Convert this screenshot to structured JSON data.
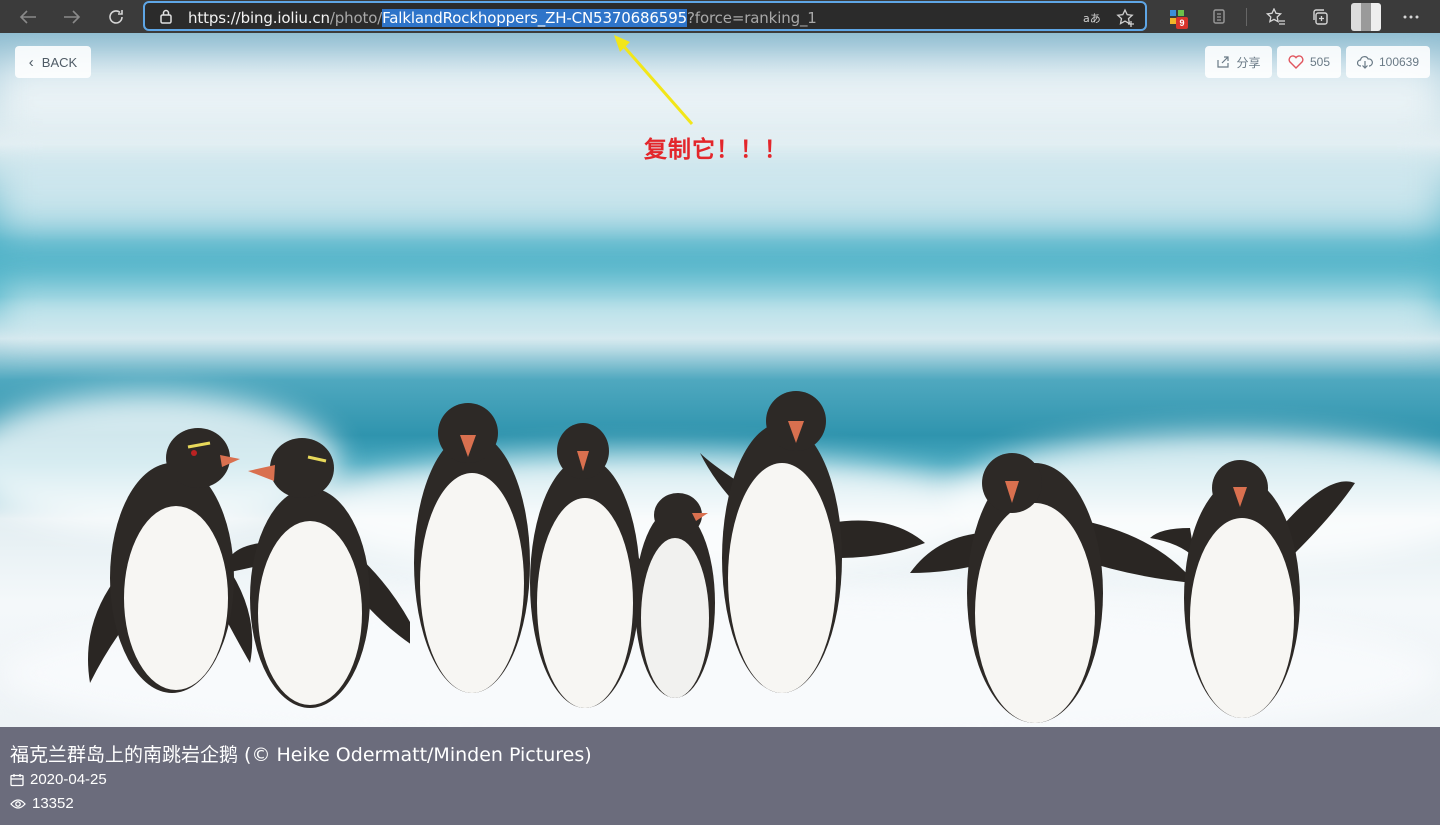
{
  "browser": {
    "url_prefix": "https://",
    "url_host": "bing.ioliu.cn",
    "url_path": "/photo/",
    "url_selected": "FalklandRockhoppers_ZH-CN5370686595",
    "url_query": "?force=ranking_1",
    "extensions_badge": "9",
    "icons": [
      "back-arrow-icon",
      "forward-arrow-icon",
      "refresh-icon",
      "lock-icon",
      "read-aloud-icon",
      "add-favorite-icon",
      "extensions-icon",
      "tab-actions-icon",
      "favorites-icon",
      "collections-icon",
      "profile-avatar",
      "more-icon"
    ]
  },
  "page": {
    "back_label": "BACK",
    "share_label": "分享",
    "likes": "505",
    "downloads": "100639"
  },
  "annotation": {
    "text": "复制它！！！",
    "color": "#e3262b"
  },
  "caption": {
    "title": "福克兰群岛上的南跳岩企鹅 (© Heike Odermatt/Minden Pictures)",
    "date": "2020-04-25",
    "views": "13352"
  },
  "colors": {
    "toolbar": "#3b3b3b",
    "address_focus": "#5ea6e6",
    "url_selection": "#2e74c9",
    "caption_bg": "#6b6c7c",
    "arrow": "#f2e619"
  }
}
